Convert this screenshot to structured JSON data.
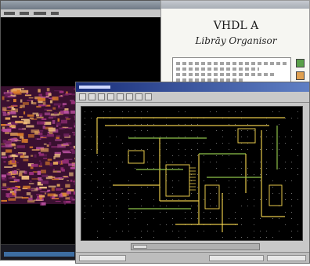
{
  "help_window": {
    "heading": "VHDL A",
    "subheading": "Librāy Organisor"
  },
  "colors": {
    "schematic_bg": "#000000",
    "wire_yellow": "#e6c84a",
    "wire_green": "#8ec24a",
    "grid_dot": "#6e6e6e",
    "layout_magenta": "#9a2f7a",
    "layout_orange": "#d77a2a"
  },
  "icons": {
    "close": "close-icon",
    "minimize": "minimize-icon",
    "toolbar": "toolbar-tool-icon"
  }
}
